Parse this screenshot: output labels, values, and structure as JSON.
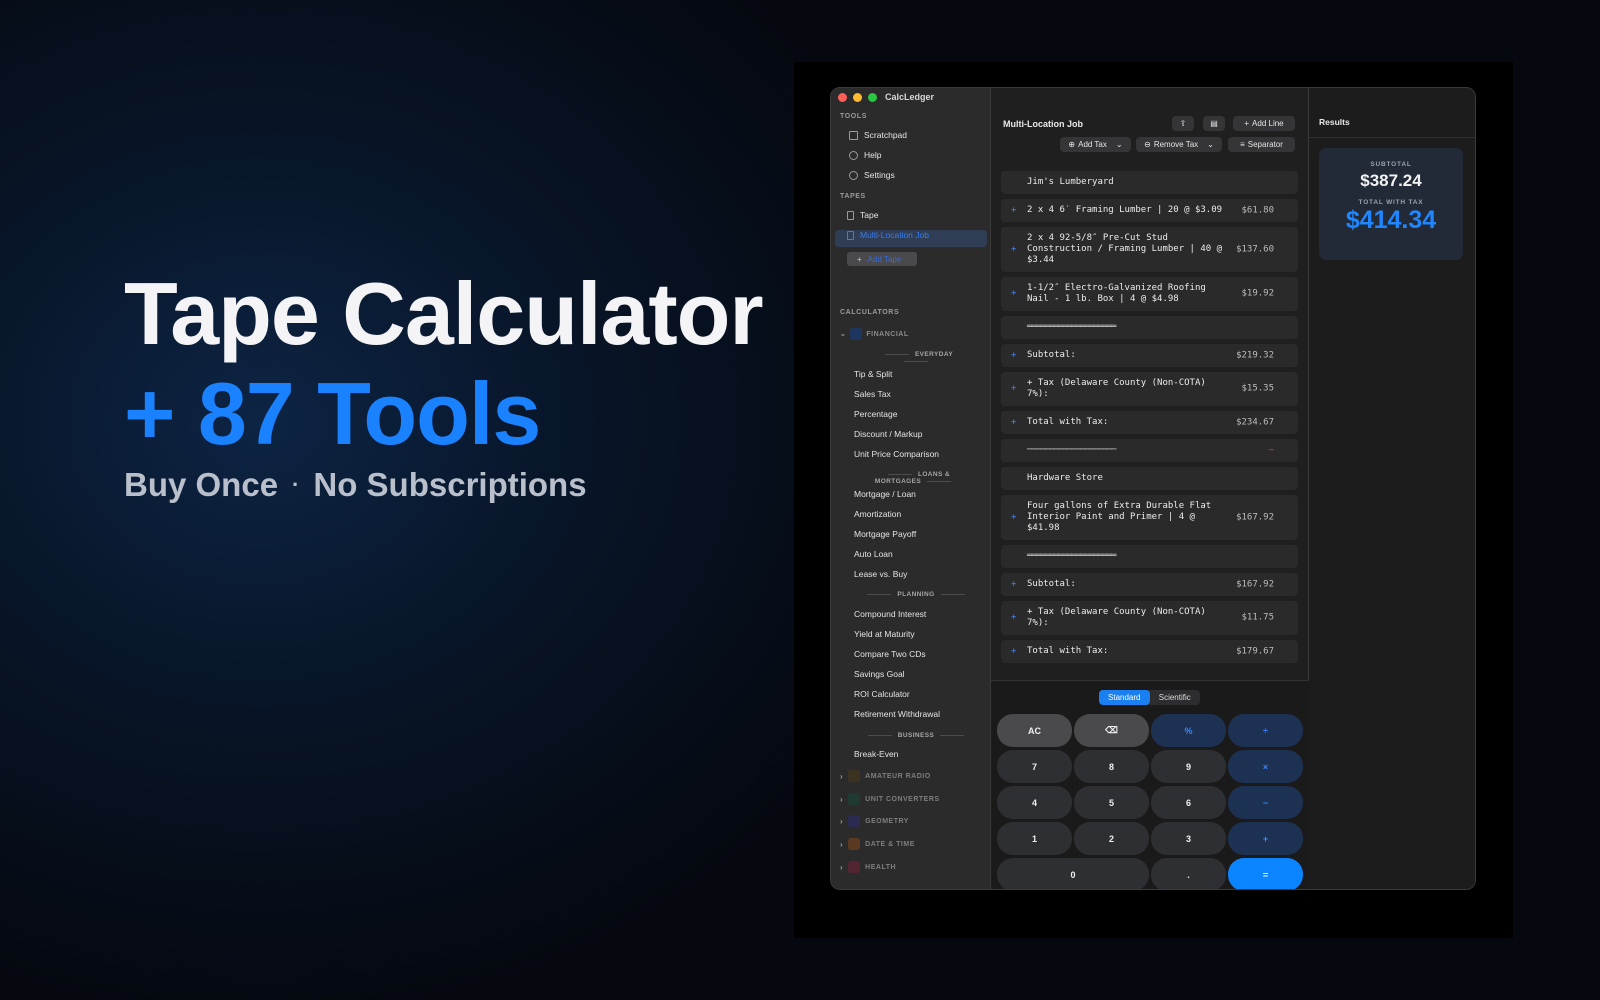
{
  "promo": {
    "line1": "Tape Calculator",
    "line2": "+ 87 Tools",
    "line3a": "Buy Once",
    "dot": "·",
    "line3b": "No Subscriptions"
  },
  "colors": {
    "accent": "#1a82ff",
    "close": "#ff5f57",
    "minimize": "#febc2e",
    "zoom": "#28c840"
  },
  "window": {
    "app_title": "CalcLedger"
  },
  "sidebar": {
    "tools_header": "TOOLS",
    "tools": [
      "Scratchpad",
      "Help",
      "Settings"
    ],
    "tapes_header": "TAPES",
    "tapes": [
      "Tape",
      "Multi-Location Job"
    ],
    "add_tape": "Add Tape",
    "calculators_header": "CALCULATORS",
    "financial": "FINANCIAL",
    "everyday_header": "EVERYDAY",
    "everyday": [
      "Tip & Split",
      "Sales Tax",
      "Percentage",
      "Discount / Markup",
      "Unit Price Comparison"
    ],
    "loans_header": "LOANS & MORTGAGES",
    "loans": [
      "Mortgage / Loan",
      "Amortization",
      "Mortgage Payoff",
      "Auto Loan",
      "Lease vs. Buy"
    ],
    "planning_header": "PLANNING",
    "planning": [
      "Compound Interest",
      "Yield at Maturity",
      "Compare Two CDs",
      "Savings Goal",
      "ROI Calculator",
      "Retirement Withdrawal"
    ],
    "business_header": "BUSINESS",
    "business": [
      "Break-Even"
    ],
    "groups": [
      "AMATEUR RADIO",
      "UNIT CONVERTERS",
      "GEOMETRY",
      "DATE & TIME",
      "HEALTH"
    ]
  },
  "main": {
    "title": "Multi-Location Job",
    "add_line": "Add Line",
    "add_tax": "Add Tax",
    "remove_tax": "Remove Tax",
    "separator": "Separator",
    "tape_rows": [
      {
        "plus": "",
        "text": "Jim's Lumberyard",
        "amount": ""
      },
      {
        "plus": "+",
        "text": "2 x 4 6′ Framing Lumber | 20 @ $3.09",
        "amount": "$61.80"
      },
      {
        "plus": "+",
        "text": "2 x 4 92-5/8″ Pre-Cut Stud Construction / Framing Lumber | 40 @ $3.44",
        "amount": "$137.60"
      },
      {
        "plus": "+",
        "text": "1-1/2″ Electro-Galvanized Roofing Nail - 1 lb. Box | 4 @ $4.98",
        "amount": "$19.92"
      },
      {
        "plus": "",
        "text": "════════════════════",
        "amount": ""
      },
      {
        "plus": "+",
        "text": "Subtotal:",
        "amount": "$219.32"
      },
      {
        "plus": "+",
        "text": "+ Tax (Delaware County (Non-COTA) 7%):",
        "amount": "$15.35"
      },
      {
        "plus": "+",
        "text": "Total with Tax:",
        "amount": "$234.67"
      },
      {
        "plus": "",
        "text": "────────────────────",
        "amount": "–",
        "red": true
      },
      {
        "plus": "",
        "text": "Hardware Store",
        "amount": ""
      },
      {
        "plus": "+",
        "text": "Four gallons of Extra Durable Flat Interior Paint and Primer | 4 @ $41.98",
        "amount": "$167.92"
      },
      {
        "plus": "",
        "text": "════════════════════",
        "amount": ""
      },
      {
        "plus": "+",
        "text": "Subtotal:",
        "amount": "$167.92"
      },
      {
        "plus": "+",
        "text": "+ Tax (Delaware County (Non-COTA) 7%):",
        "amount": "$11.75"
      },
      {
        "plus": "+",
        "text": "Total with Tax:",
        "amount": "$179.67"
      }
    ],
    "mode_standard": "Standard",
    "mode_scientific": "Scientific",
    "keys": [
      {
        "label": "AC",
        "kind": "gray"
      },
      {
        "label": "⌫",
        "kind": "gray"
      },
      {
        "label": "%",
        "kind": "op"
      },
      {
        "label": "÷",
        "kind": "op"
      },
      {
        "label": "7",
        "kind": "num"
      },
      {
        "label": "8",
        "kind": "num"
      },
      {
        "label": "9",
        "kind": "num"
      },
      {
        "label": "×",
        "kind": "op"
      },
      {
        "label": "4",
        "kind": "num"
      },
      {
        "label": "5",
        "kind": "num"
      },
      {
        "label": "6",
        "kind": "num"
      },
      {
        "label": "−",
        "kind": "op"
      },
      {
        "label": "1",
        "kind": "num"
      },
      {
        "label": "2",
        "kind": "num"
      },
      {
        "label": "3",
        "kind": "num"
      },
      {
        "label": "+",
        "kind": "op"
      },
      {
        "label": "0",
        "kind": "zero"
      },
      {
        "label": ".",
        "kind": "num"
      },
      {
        "label": "=",
        "kind": "eq"
      }
    ]
  },
  "results": {
    "title": "Results",
    "subtotal_label": "SUBTOTAL",
    "subtotal": "$387.24",
    "total_label": "TOTAL WITH TAX",
    "total": "$414.34"
  }
}
